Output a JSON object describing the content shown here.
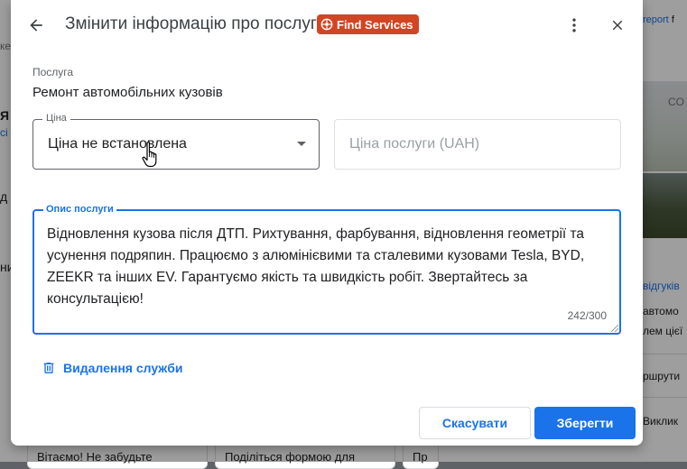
{
  "background": {
    "report_link": "report",
    "report_suffix": "f",
    "map_text": "CO",
    "reviews_text": "відгуків",
    "auto_text": "автомо",
    "who_text": "лем цієї",
    "route_text": "ршрути",
    "call_text": "Виклик",
    "left_letters": [
      "ке",
      "Я",
      "сі",
      "д",
      "ни"
    ],
    "cards": [
      "Вітаємо! Не забудьте",
      "Поділіться формою для",
      "Пр"
    ]
  },
  "dialog": {
    "title": "Змінити інформацію про послугу",
    "badge_label": "Find Services",
    "service_label": "Послуга",
    "service_name": "Ремонт автомобільних кузовів",
    "price_select": {
      "legend": "Ціна",
      "value": "Ціна не встановлена"
    },
    "price_input": {
      "placeholder": "Ціна послуги (UAH)"
    },
    "description": {
      "legend": "Опис послуги",
      "text": "Відновлення кузова після ДТП. Рихтування, фарбування, відновлення геометрії та усунення подряпин. Працюємо з алюмінієвими та сталевими кузовами Tesla, BYD, ZEEKR та інших EV. Гарантуємо якість та швидкість робіт. Звертайтесь за консультацією!",
      "counter": "242/300"
    },
    "delete_label": "Видалення служби",
    "cancel_label": "Скасувати",
    "save_label": "Зберегти"
  },
  "colors": {
    "accent": "#1a73e8",
    "badge": "#d24523"
  },
  "icons": [
    "back-arrow-icon",
    "find-services-icon",
    "more-vert-icon",
    "close-icon",
    "trash-icon",
    "chevron-down-icon",
    "hand-cursor-icon"
  ]
}
